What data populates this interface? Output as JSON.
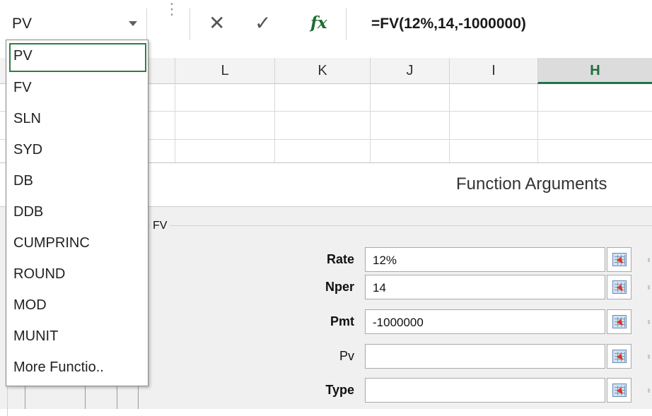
{
  "namebox": {
    "value": "PV"
  },
  "formula": {
    "text": "=FV(12%,14,-1000000)",
    "fx_label": "fx"
  },
  "columns": [
    "L",
    "K",
    "J",
    "I",
    "H"
  ],
  "dropdown": {
    "items": [
      "PV",
      "FV",
      "SLN",
      "SYD",
      "DB",
      "DDB",
      "CUMPRINC",
      "ROUND",
      "MOD",
      "MUNIT",
      "More Functio.."
    ],
    "selected_index": 0
  },
  "dialog": {
    "title": "Function Arguments",
    "function_name": "FV",
    "args": [
      {
        "label": "Rate",
        "value": "12%"
      },
      {
        "label": "Nper",
        "value": "14"
      },
      {
        "label": "Pmt",
        "value": "-1000000"
      },
      {
        "label": "Pv",
        "value": ""
      },
      {
        "label": "Type",
        "value": ""
      }
    ]
  },
  "colors": {
    "accent": "#217346",
    "fx": "#1f6b30"
  }
}
